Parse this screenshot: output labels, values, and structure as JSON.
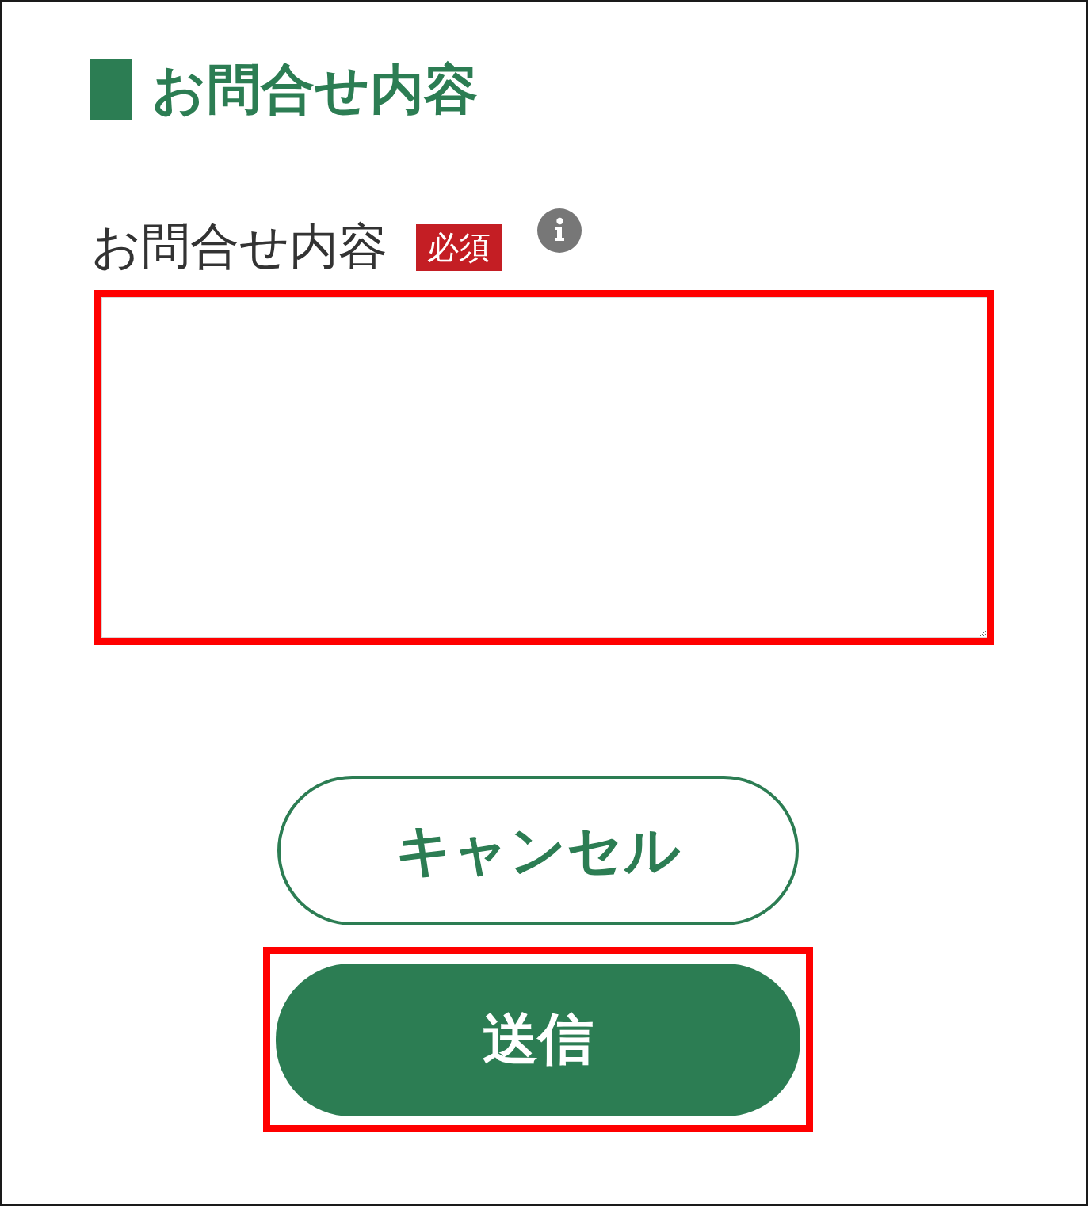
{
  "section": {
    "title": "お問合せ内容"
  },
  "field": {
    "label": "お問合せ内容",
    "badge": "必須",
    "highlighted": true
  },
  "buttons": [
    {
      "label": "キャンセル",
      "kind": "outline",
      "highlighted": false
    },
    {
      "label": "送信",
      "kind": "primary",
      "highlighted": true
    }
  ]
}
